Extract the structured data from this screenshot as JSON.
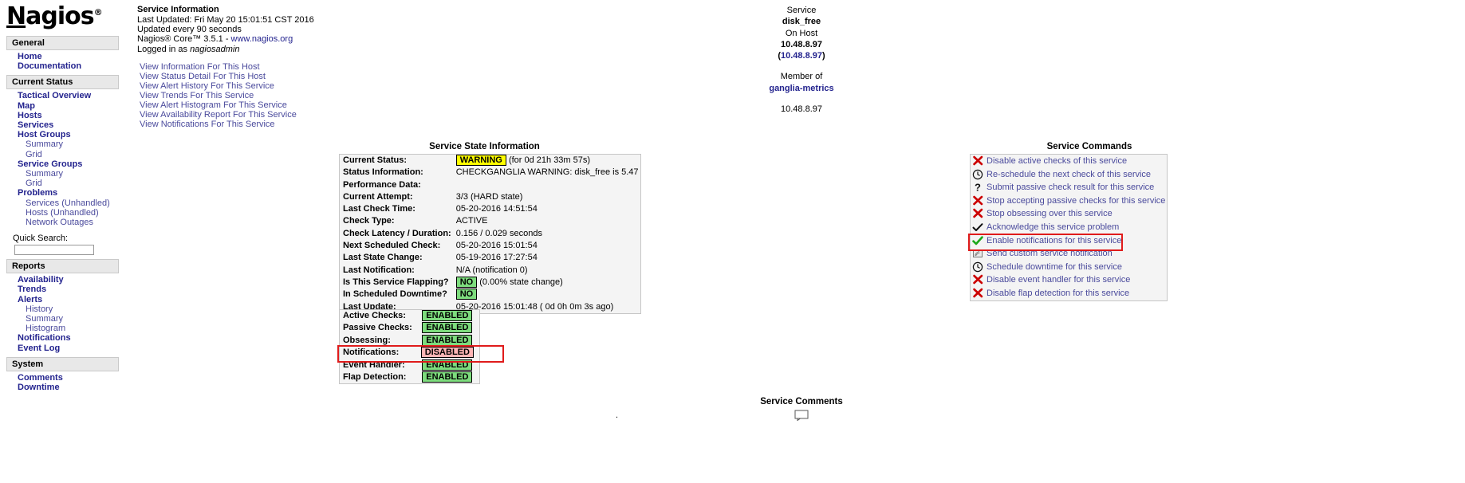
{
  "brand": {
    "name_prefix": "N",
    "name_rest": "agios",
    "registered": "®"
  },
  "sidebar": {
    "sections": [
      {
        "header": "General",
        "items": [
          {
            "label": "Home",
            "sub": false
          },
          {
            "label": "Documentation",
            "sub": false
          }
        ]
      },
      {
        "header": "Current Status",
        "items": [
          {
            "label": "Tactical Overview",
            "sub": false
          },
          {
            "label": "Map",
            "sub": false
          },
          {
            "label": "Hosts",
            "sub": false
          },
          {
            "label": "Services",
            "sub": false
          },
          {
            "label": "Host Groups",
            "sub": false
          },
          {
            "label": "Summary",
            "sub": true
          },
          {
            "label": "Grid",
            "sub": true
          },
          {
            "label": "Service Groups",
            "sub": false
          },
          {
            "label": "Summary",
            "sub": true
          },
          {
            "label": "Grid",
            "sub": true
          },
          {
            "label": "Problems",
            "sub": false
          },
          {
            "label": "Services (Unhandled)",
            "sub": true
          },
          {
            "label": "Hosts (Unhandled)",
            "sub": true
          },
          {
            "label": "Network Outages",
            "sub": true
          }
        ]
      },
      {
        "header": "Reports",
        "items": [
          {
            "label": "Availability",
            "sub": false
          },
          {
            "label": "Trends",
            "sub": false
          },
          {
            "label": "Alerts",
            "sub": false
          },
          {
            "label": "History",
            "sub": true
          },
          {
            "label": "Summary",
            "sub": true
          },
          {
            "label": "Histogram",
            "sub": true
          },
          {
            "label": "Notifications",
            "sub": false
          },
          {
            "label": "Event Log",
            "sub": false
          }
        ]
      },
      {
        "header": "System",
        "items": [
          {
            "label": "Comments",
            "sub": false
          },
          {
            "label": "Downtime",
            "sub": false
          }
        ]
      }
    ],
    "quick_search": {
      "label": "Quick Search:",
      "value": "",
      "placeholder": ""
    }
  },
  "info": {
    "title": "Service Information",
    "last_updated": "Last Updated: Fri May 20 15:01:51 CST 2016",
    "update_interval": "Updated every 90 seconds",
    "version_prefix": "Nagios® Core™ 3.5.1 - ",
    "version_link": "www.nagios.org",
    "logged_in_prefix": "Logged in as ",
    "logged_in_user": "nagiosadmin",
    "view_links": [
      "View Information For This Host",
      "View Status Detail For This Host",
      "View Alert History For This Service",
      "View Trends For This Service",
      "View Alert Histogram For This Service",
      "View Availability Report For This Service",
      "View Notifications For This Service"
    ]
  },
  "service_header": {
    "service_label": "Service",
    "service_name": "disk_free",
    "on_host_label": "On Host",
    "host_name": "10.48.8.97",
    "host_address_open": "(",
    "host_address": "10.48.8.97",
    "host_address_close": ")",
    "member_of_label": "Member of",
    "service_group": "ganglia-metrics",
    "extra_address": "10.48.8.97"
  },
  "state": {
    "title": "Service State Information",
    "rows": [
      {
        "label": "Current Status:",
        "badge": "WARNING",
        "badge_type": "warning",
        "note": "(for 0d 21h 33m 57s)"
      },
      {
        "label": "Status Information:",
        "value": "CHECKGANGLIA WARNING: disk_free is 5.47"
      },
      {
        "label": "Performance Data:",
        "value": ""
      },
      {
        "label": "Current Attempt:",
        "value": "3/3  (HARD state)"
      },
      {
        "label": "Last Check Time:",
        "value": "05-20-2016 14:51:54"
      },
      {
        "label": "Check Type:",
        "value": "ACTIVE"
      },
      {
        "label": "Check Latency / Duration:",
        "value": "0.156 / 0.029 seconds"
      },
      {
        "label": "Next Scheduled Check:",
        "value": "05-20-2016 15:01:54"
      },
      {
        "label": "Last State Change:",
        "value": "05-19-2016 17:27:54"
      },
      {
        "label": "Last Notification:",
        "value": "N/A (notification 0)"
      },
      {
        "label": "Is This Service Flapping?",
        "badge": "NO",
        "badge_type": "green",
        "note": "(0.00% state change)"
      },
      {
        "label": "In Scheduled Downtime?",
        "badge": "NO",
        "badge_type": "green",
        "note": ""
      },
      {
        "label": "Last Update:",
        "value": "05-20-2016 15:01:48  ( 0d 0h 0m 3s ago)"
      }
    ]
  },
  "attributes": {
    "rows": [
      {
        "label": "Active Checks:",
        "value": "ENABLED",
        "type": "green",
        "highlighted": false
      },
      {
        "label": "Passive Checks:",
        "value": "ENABLED",
        "type": "green",
        "highlighted": false
      },
      {
        "label": "Obsessing:",
        "value": "ENABLED",
        "type": "green",
        "highlighted": false
      },
      {
        "label": "Notifications:",
        "value": "DISABLED",
        "type": "red",
        "highlighted": true
      },
      {
        "label": "Event Handler:",
        "value": "ENABLED",
        "type": "green",
        "highlighted": false
      },
      {
        "label": "Flap Detection:",
        "value": "ENABLED",
        "type": "green",
        "highlighted": false
      }
    ]
  },
  "commands": {
    "title": "Service Commands",
    "items": [
      {
        "icon": "red-x-icon",
        "label": "Disable active checks of this service",
        "highlighted": false
      },
      {
        "icon": "clock-icon",
        "label": "Re-schedule the next check of this service",
        "highlighted": false
      },
      {
        "icon": "question-mark-icon",
        "label": "Submit passive check result for this service",
        "highlighted": false
      },
      {
        "icon": "red-x-icon",
        "label": "Stop accepting passive checks for this service",
        "highlighted": false
      },
      {
        "icon": "red-x-icon",
        "label": "Stop obsessing over this service",
        "highlighted": false
      },
      {
        "icon": "black-check-icon",
        "label": "Acknowledge this service problem",
        "highlighted": false
      },
      {
        "icon": "green-check-icon",
        "label": "Enable notifications for this service",
        "highlighted": true
      },
      {
        "icon": "send-notification-icon",
        "label": "Send custom service notification",
        "highlighted": false
      },
      {
        "icon": "clock-icon",
        "label": "Schedule downtime for this service",
        "highlighted": false
      },
      {
        "icon": "red-x-icon",
        "label": "Disable event handler for this service",
        "highlighted": false
      },
      {
        "icon": "red-x-icon",
        "label": "Disable flap detection for this service",
        "highlighted": false
      }
    ]
  },
  "comments": {
    "title": "Service Comments"
  },
  "colors": {
    "link": "#23238e",
    "link_soft": "#4a4a9c",
    "warning": "#ffff00",
    "ok_green": "#7ddc7d",
    "critical_red": "#ffb5b5",
    "highlight_box": "#e01b1b",
    "panel_bg": "#f4f4f4",
    "header_bg": "#e8e8e8"
  }
}
